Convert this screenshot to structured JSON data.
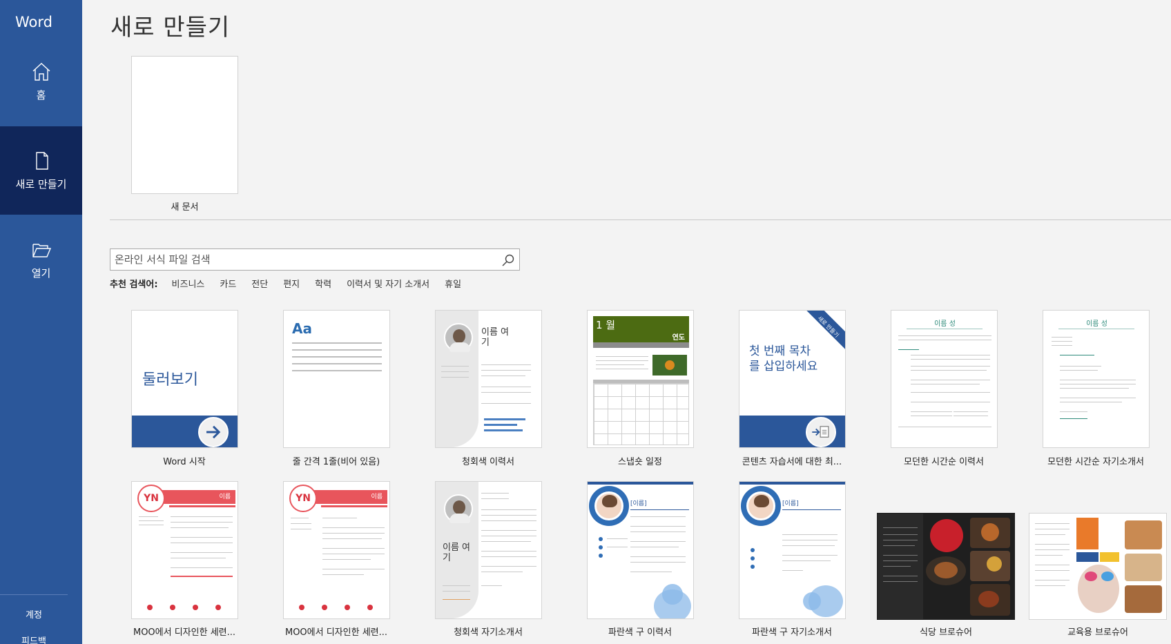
{
  "app": {
    "name": "Word"
  },
  "sidebar": {
    "items": [
      {
        "label": "홈",
        "icon": "home-icon"
      },
      {
        "label": "새로 만들기",
        "icon": "new-document-icon",
        "active": true
      },
      {
        "label": "열기",
        "icon": "folder-open-icon"
      }
    ],
    "bottom": [
      {
        "label": "계정"
      },
      {
        "label": "피드백"
      }
    ]
  },
  "main": {
    "title": "새로 만들기",
    "blank_document_label": "새 문서",
    "search": {
      "placeholder": "온라인 서식 파일 검색",
      "icon": "search-icon"
    },
    "suggested": {
      "label": "추천 검색어:",
      "items": [
        "비즈니스",
        "카드",
        "전단",
        "편지",
        "학력",
        "이력서 및 자기 소개서",
        "휴일"
      ]
    },
    "templates": [
      {
        "label": "Word 시작",
        "thumb_text": "둘러보기"
      },
      {
        "label": "줄 간격 1줄(비어 있음)",
        "thumb_text": "Aa"
      },
      {
        "label": "청회색 이력서",
        "thumb_text": "이름 여기"
      },
      {
        "label": "스냅숏 일정",
        "thumb_text": "1 월",
        "thumb_sub": "연도"
      },
      {
        "label": "콘텐츠 자습서에 대한 최...",
        "thumb_text": "첫 번째 목차를 삽입하세요",
        "thumb_badge": "새로 만들기"
      },
      {
        "label": "모던한 시간순 이력서",
        "thumb_text": "이름 성"
      },
      {
        "label": "모던한 시간순 자기소개서",
        "thumb_text": "이름 성"
      },
      {
        "label": "MOO에서 디자인한 세련...",
        "thumb_text": "YN",
        "thumb_sub": "이름"
      },
      {
        "label": "MOO에서 디자인한 세련...",
        "thumb_text": "YN",
        "thumb_sub": "이름"
      },
      {
        "label": "청회색 자기소개서",
        "thumb_text": "이름 여기"
      },
      {
        "label": "파란색 구 이력서",
        "thumb_text": "[이름]"
      },
      {
        "label": "파란색 구 자기소개서",
        "thumb_text": "[이름]"
      },
      {
        "label": "식당 브로슈어"
      },
      {
        "label": "교육용 브로슈어"
      }
    ]
  },
  "colors": {
    "sidebar": "#2b579a",
    "sidebar_active": "#10265a",
    "accent_blue": "#2b579a",
    "accent_red": "#d9333f",
    "green": "#4c6b12"
  }
}
